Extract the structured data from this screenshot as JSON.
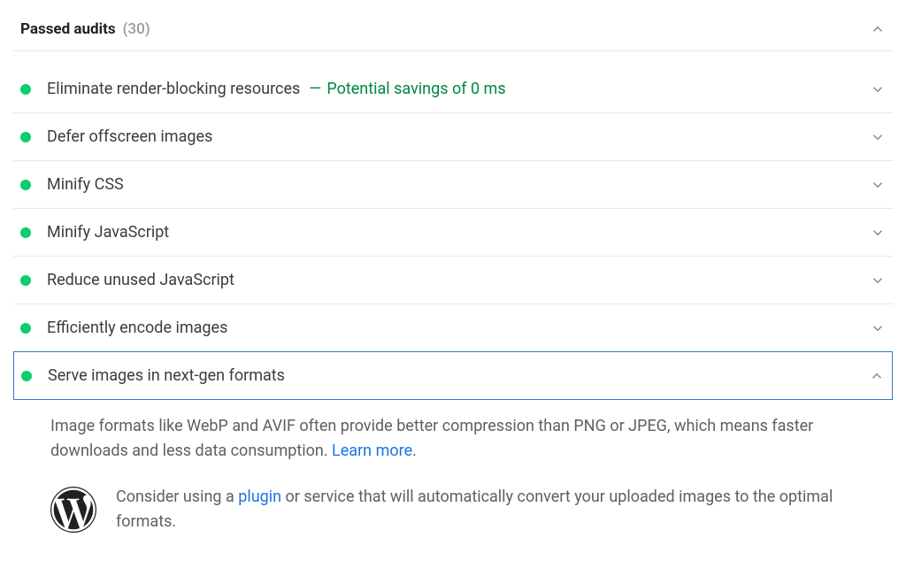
{
  "section": {
    "title": "Passed audits",
    "count": "(30)"
  },
  "audits": [
    {
      "label": "Eliminate render-blocking resources",
      "extra": "Potential savings of 0 ms"
    },
    {
      "label": "Defer offscreen images"
    },
    {
      "label": "Minify CSS"
    },
    {
      "label": "Minify JavaScript"
    },
    {
      "label": "Reduce unused JavaScript"
    },
    {
      "label": "Efficiently encode images"
    },
    {
      "label": "Serve images in next-gen formats",
      "expanded": true
    }
  ],
  "detail": {
    "text_before": "Image formats like WebP and AVIF often provide better compression than PNG or JPEG, which means faster downloads and less data consumption. ",
    "learn_more": "Learn more",
    "text_after": ".",
    "rec_before": "Consider using a ",
    "rec_link": "plugin",
    "rec_after": " or service that will automatically convert your uploaded images to the optimal formats."
  }
}
